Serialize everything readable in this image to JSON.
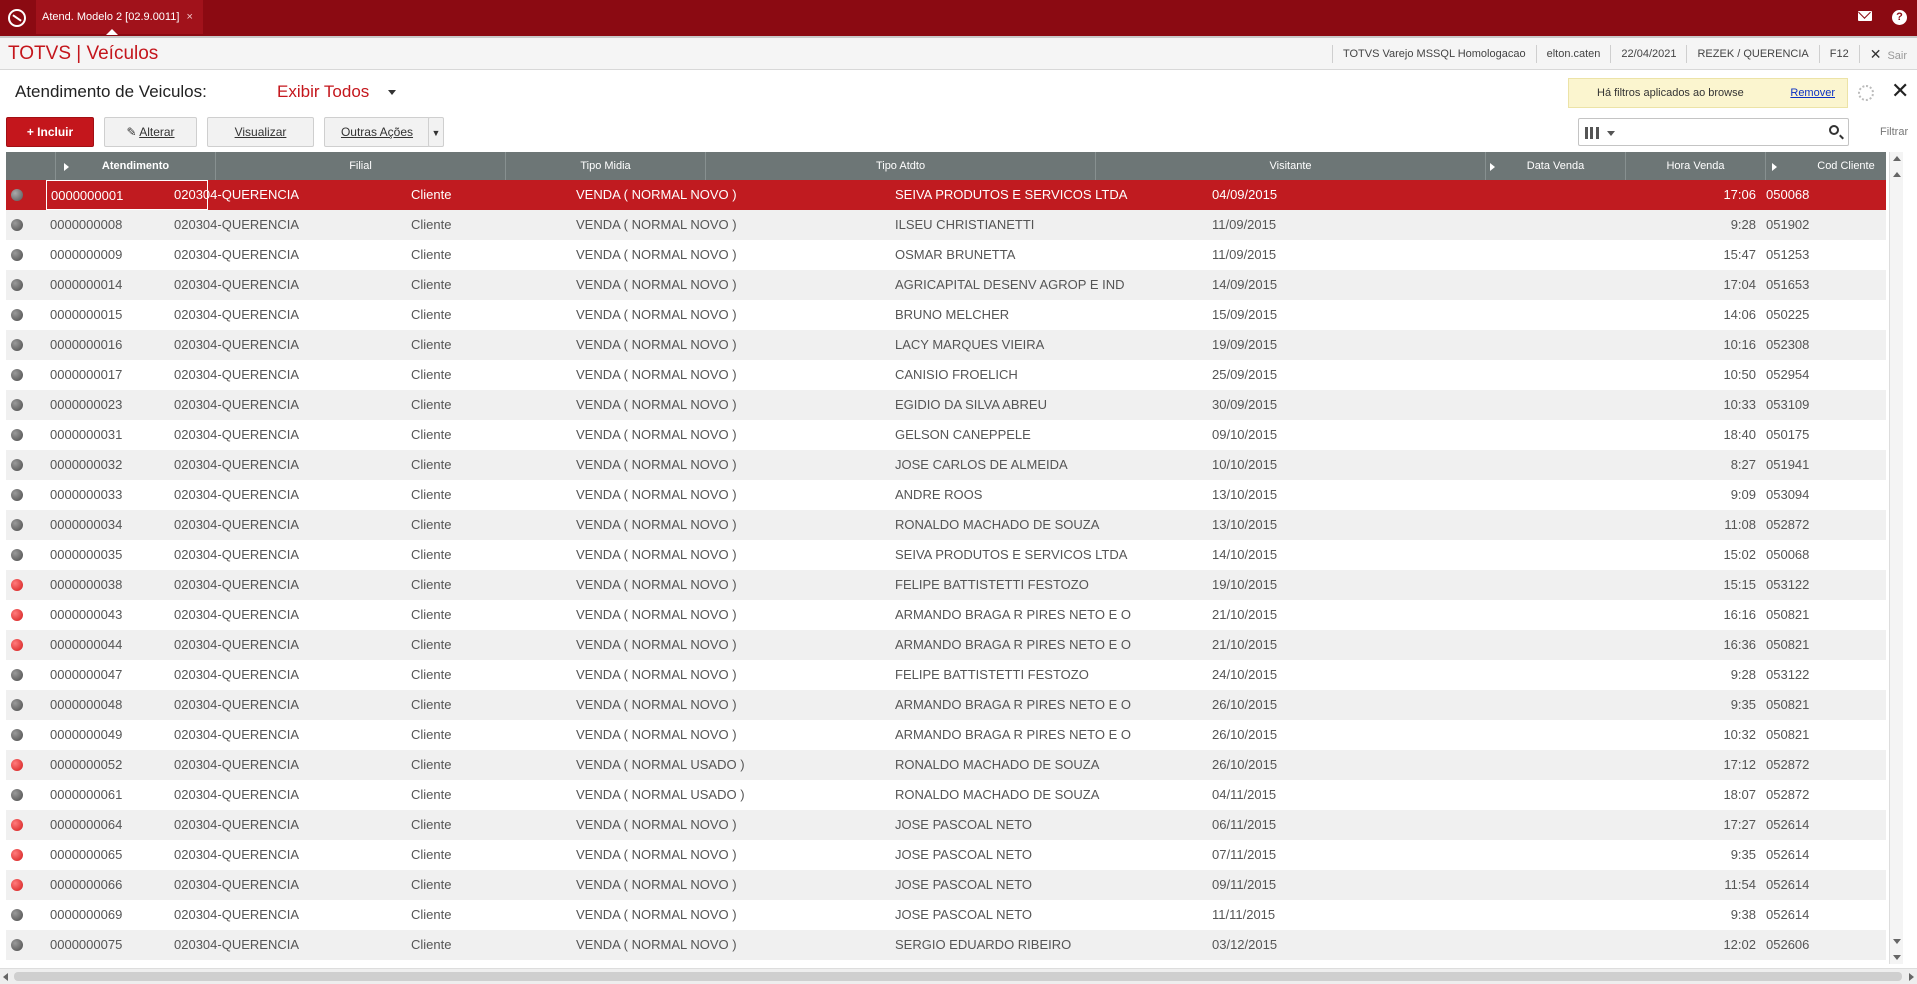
{
  "topbar": {
    "tab_label": "Atend. Modelo 2 [02.9.0011]",
    "tab_close": "×"
  },
  "app": {
    "title": "TOTVS | Veículos",
    "environment": "TOTVS Varejo MSSQL Homologacao",
    "user": "elton.caten",
    "date": "22/04/2021",
    "company": "REZEK / QUERENCIA",
    "shortcut": "F12",
    "exit_label": "Sair"
  },
  "header": {
    "label": "Atendimento de Veiculos:",
    "view_selector": "Exibir Todos",
    "filter_message": "Há filtros aplicados ao browse",
    "remove_filter": "Remover"
  },
  "toolbar": {
    "add_label": "Incluir",
    "edit_label": "Alterar",
    "view_label": "Visualizar",
    "more_label": "Outras Ações",
    "search_placeholder": "",
    "filter_label": "Filtrar"
  },
  "colors": {
    "brand": "#8b0a12",
    "accent": "#c4161c",
    "header_grid": "#6d7676",
    "selected_row": "#c01b20"
  },
  "grid": {
    "columns": [
      "",
      "Atendimento",
      "Filial",
      "Tipo Midia",
      "Tipo Atdto",
      "Visitante",
      "Data Venda",
      "Hora Venda",
      "Cod Cliente"
    ],
    "rows": [
      {
        "status": "gray",
        "atendimento": "0000000001",
        "filial": "020304-QUERENCIA",
        "midia": "Cliente",
        "atdto": "VENDA ( NORMAL NOVO )",
        "visitante": "SEIVA PRODUTOS E SERVICOS LTDA",
        "data": "04/09/2015",
        "hora": "17:06",
        "cliente": "050068"
      },
      {
        "status": "gray",
        "atendimento": "0000000008",
        "filial": "020304-QUERENCIA",
        "midia": "Cliente",
        "atdto": "VENDA ( NORMAL NOVO )",
        "visitante": "ILSEU CHRISTIANETTI",
        "data": "11/09/2015",
        "hora": "9:28",
        "cliente": "051902"
      },
      {
        "status": "gray",
        "atendimento": "0000000009",
        "filial": "020304-QUERENCIA",
        "midia": "Cliente",
        "atdto": "VENDA ( NORMAL NOVO )",
        "visitante": "OSMAR BRUNETTA",
        "data": "11/09/2015",
        "hora": "15:47",
        "cliente": "051253"
      },
      {
        "status": "gray",
        "atendimento": "0000000014",
        "filial": "020304-QUERENCIA",
        "midia": "Cliente",
        "atdto": "VENDA ( NORMAL NOVO )",
        "visitante": "AGRICAPITAL DESENV AGROP E IND",
        "data": "14/09/2015",
        "hora": "17:04",
        "cliente": "051653"
      },
      {
        "status": "gray",
        "atendimento": "0000000015",
        "filial": "020304-QUERENCIA",
        "midia": "Cliente",
        "atdto": "VENDA ( NORMAL NOVO )",
        "visitante": "BRUNO MELCHER",
        "data": "15/09/2015",
        "hora": "14:06",
        "cliente": "050225"
      },
      {
        "status": "gray",
        "atendimento": "0000000016",
        "filial": "020304-QUERENCIA",
        "midia": "Cliente",
        "atdto": "VENDA ( NORMAL NOVO )",
        "visitante": "LACY MARQUES VIEIRA",
        "data": "19/09/2015",
        "hora": "10:16",
        "cliente": "052308"
      },
      {
        "status": "gray",
        "atendimento": "0000000017",
        "filial": "020304-QUERENCIA",
        "midia": "Cliente",
        "atdto": "VENDA ( NORMAL NOVO )",
        "visitante": "CANISIO FROELICH",
        "data": "25/09/2015",
        "hora": "10:50",
        "cliente": "052954"
      },
      {
        "status": "gray",
        "atendimento": "0000000023",
        "filial": "020304-QUERENCIA",
        "midia": "Cliente",
        "atdto": "VENDA ( NORMAL NOVO )",
        "visitante": "EGIDIO DA SILVA ABREU",
        "data": "30/09/2015",
        "hora": "10:33",
        "cliente": "053109"
      },
      {
        "status": "gray",
        "atendimento": "0000000031",
        "filial": "020304-QUERENCIA",
        "midia": "Cliente",
        "atdto": "VENDA ( NORMAL NOVO )",
        "visitante": "GELSON CANEPPELE",
        "data": "09/10/2015",
        "hora": "18:40",
        "cliente": "050175"
      },
      {
        "status": "gray",
        "atendimento": "0000000032",
        "filial": "020304-QUERENCIA",
        "midia": "Cliente",
        "atdto": "VENDA ( NORMAL NOVO )",
        "visitante": "JOSE CARLOS  DE ALMEIDA",
        "data": "10/10/2015",
        "hora": "8:27",
        "cliente": "051941"
      },
      {
        "status": "gray",
        "atendimento": "0000000033",
        "filial": "020304-QUERENCIA",
        "midia": "Cliente",
        "atdto": "VENDA ( NORMAL NOVO )",
        "visitante": "ANDRE ROOS",
        "data": "13/10/2015",
        "hora": "9:09",
        "cliente": "053094"
      },
      {
        "status": "gray",
        "atendimento": "0000000034",
        "filial": "020304-QUERENCIA",
        "midia": "Cliente",
        "atdto": "VENDA ( NORMAL NOVO )",
        "visitante": "RONALDO MACHADO DE SOUZA",
        "data": "13/10/2015",
        "hora": "11:08",
        "cliente": "052872"
      },
      {
        "status": "gray",
        "atendimento": "0000000035",
        "filial": "020304-QUERENCIA",
        "midia": "Cliente",
        "atdto": "VENDA ( NORMAL NOVO )",
        "visitante": "SEIVA PRODUTOS E SERVICOS LTDA",
        "data": "14/10/2015",
        "hora": "15:02",
        "cliente": "050068"
      },
      {
        "status": "red",
        "atendimento": "0000000038",
        "filial": "020304-QUERENCIA",
        "midia": "Cliente",
        "atdto": "VENDA ( NORMAL NOVO )",
        "visitante": "FELIPE BATTISTETTI FESTOZO",
        "data": "19/10/2015",
        "hora": "15:15",
        "cliente": "053122"
      },
      {
        "status": "red",
        "atendimento": "0000000043",
        "filial": "020304-QUERENCIA",
        "midia": "Cliente",
        "atdto": "VENDA ( NORMAL NOVO )",
        "visitante": "ARMANDO BRAGA R PIRES NETO E O",
        "data": "21/10/2015",
        "hora": "16:16",
        "cliente": "050821"
      },
      {
        "status": "red",
        "atendimento": "0000000044",
        "filial": "020304-QUERENCIA",
        "midia": "Cliente",
        "atdto": "VENDA ( NORMAL NOVO )",
        "visitante": "ARMANDO BRAGA R PIRES NETO E O",
        "data": "21/10/2015",
        "hora": "16:36",
        "cliente": "050821"
      },
      {
        "status": "gray",
        "atendimento": "0000000047",
        "filial": "020304-QUERENCIA",
        "midia": "Cliente",
        "atdto": "VENDA ( NORMAL NOVO )",
        "visitante": "FELIPE BATTISTETTI FESTOZO",
        "data": "24/10/2015",
        "hora": "9:28",
        "cliente": "053122"
      },
      {
        "status": "gray",
        "atendimento": "0000000048",
        "filial": "020304-QUERENCIA",
        "midia": "Cliente",
        "atdto": "VENDA ( NORMAL NOVO )",
        "visitante": "ARMANDO BRAGA R PIRES NETO E O",
        "data": "26/10/2015",
        "hora": "9:35",
        "cliente": "050821"
      },
      {
        "status": "gray",
        "atendimento": "0000000049",
        "filial": "020304-QUERENCIA",
        "midia": "Cliente",
        "atdto": "VENDA ( NORMAL NOVO )",
        "visitante": "ARMANDO BRAGA R PIRES NETO E O",
        "data": "26/10/2015",
        "hora": "10:32",
        "cliente": "050821"
      },
      {
        "status": "red",
        "atendimento": "0000000052",
        "filial": "020304-QUERENCIA",
        "midia": "Cliente",
        "atdto": "VENDA ( NORMAL USADO )",
        "visitante": "RONALDO MACHADO DE SOUZA",
        "data": "26/10/2015",
        "hora": "17:12",
        "cliente": "052872"
      },
      {
        "status": "gray",
        "atendimento": "0000000061",
        "filial": "020304-QUERENCIA",
        "midia": "Cliente",
        "atdto": "VENDA ( NORMAL USADO )",
        "visitante": "RONALDO MACHADO DE SOUZA",
        "data": "04/11/2015",
        "hora": "18:07",
        "cliente": "052872"
      },
      {
        "status": "red",
        "atendimento": "0000000064",
        "filial": "020304-QUERENCIA",
        "midia": "Cliente",
        "atdto": "VENDA ( NORMAL NOVO )",
        "visitante": "JOSE PASCOAL NETO",
        "data": "06/11/2015",
        "hora": "17:27",
        "cliente": "052614"
      },
      {
        "status": "red",
        "atendimento": "0000000065",
        "filial": "020304-QUERENCIA",
        "midia": "Cliente",
        "atdto": "VENDA ( NORMAL NOVO )",
        "visitante": "JOSE PASCOAL NETO",
        "data": "07/11/2015",
        "hora": "9:35",
        "cliente": "052614"
      },
      {
        "status": "red",
        "atendimento": "0000000066",
        "filial": "020304-QUERENCIA",
        "midia": "Cliente",
        "atdto": "VENDA ( NORMAL NOVO )",
        "visitante": "JOSE PASCOAL NETO",
        "data": "09/11/2015",
        "hora": "11:54",
        "cliente": "052614"
      },
      {
        "status": "gray",
        "atendimento": "0000000069",
        "filial": "020304-QUERENCIA",
        "midia": "Cliente",
        "atdto": "VENDA ( NORMAL NOVO )",
        "visitante": "JOSE PASCOAL NETO",
        "data": "11/11/2015",
        "hora": "9:38",
        "cliente": "052614"
      },
      {
        "status": "gray",
        "atendimento": "0000000075",
        "filial": "020304-QUERENCIA",
        "midia": "Cliente",
        "atdto": "VENDA ( NORMAL NOVO )",
        "visitante": "SERGIO EDUARDO RIBEIRO",
        "data": "03/12/2015",
        "hora": "12:02",
        "cliente": "052606"
      }
    ]
  }
}
